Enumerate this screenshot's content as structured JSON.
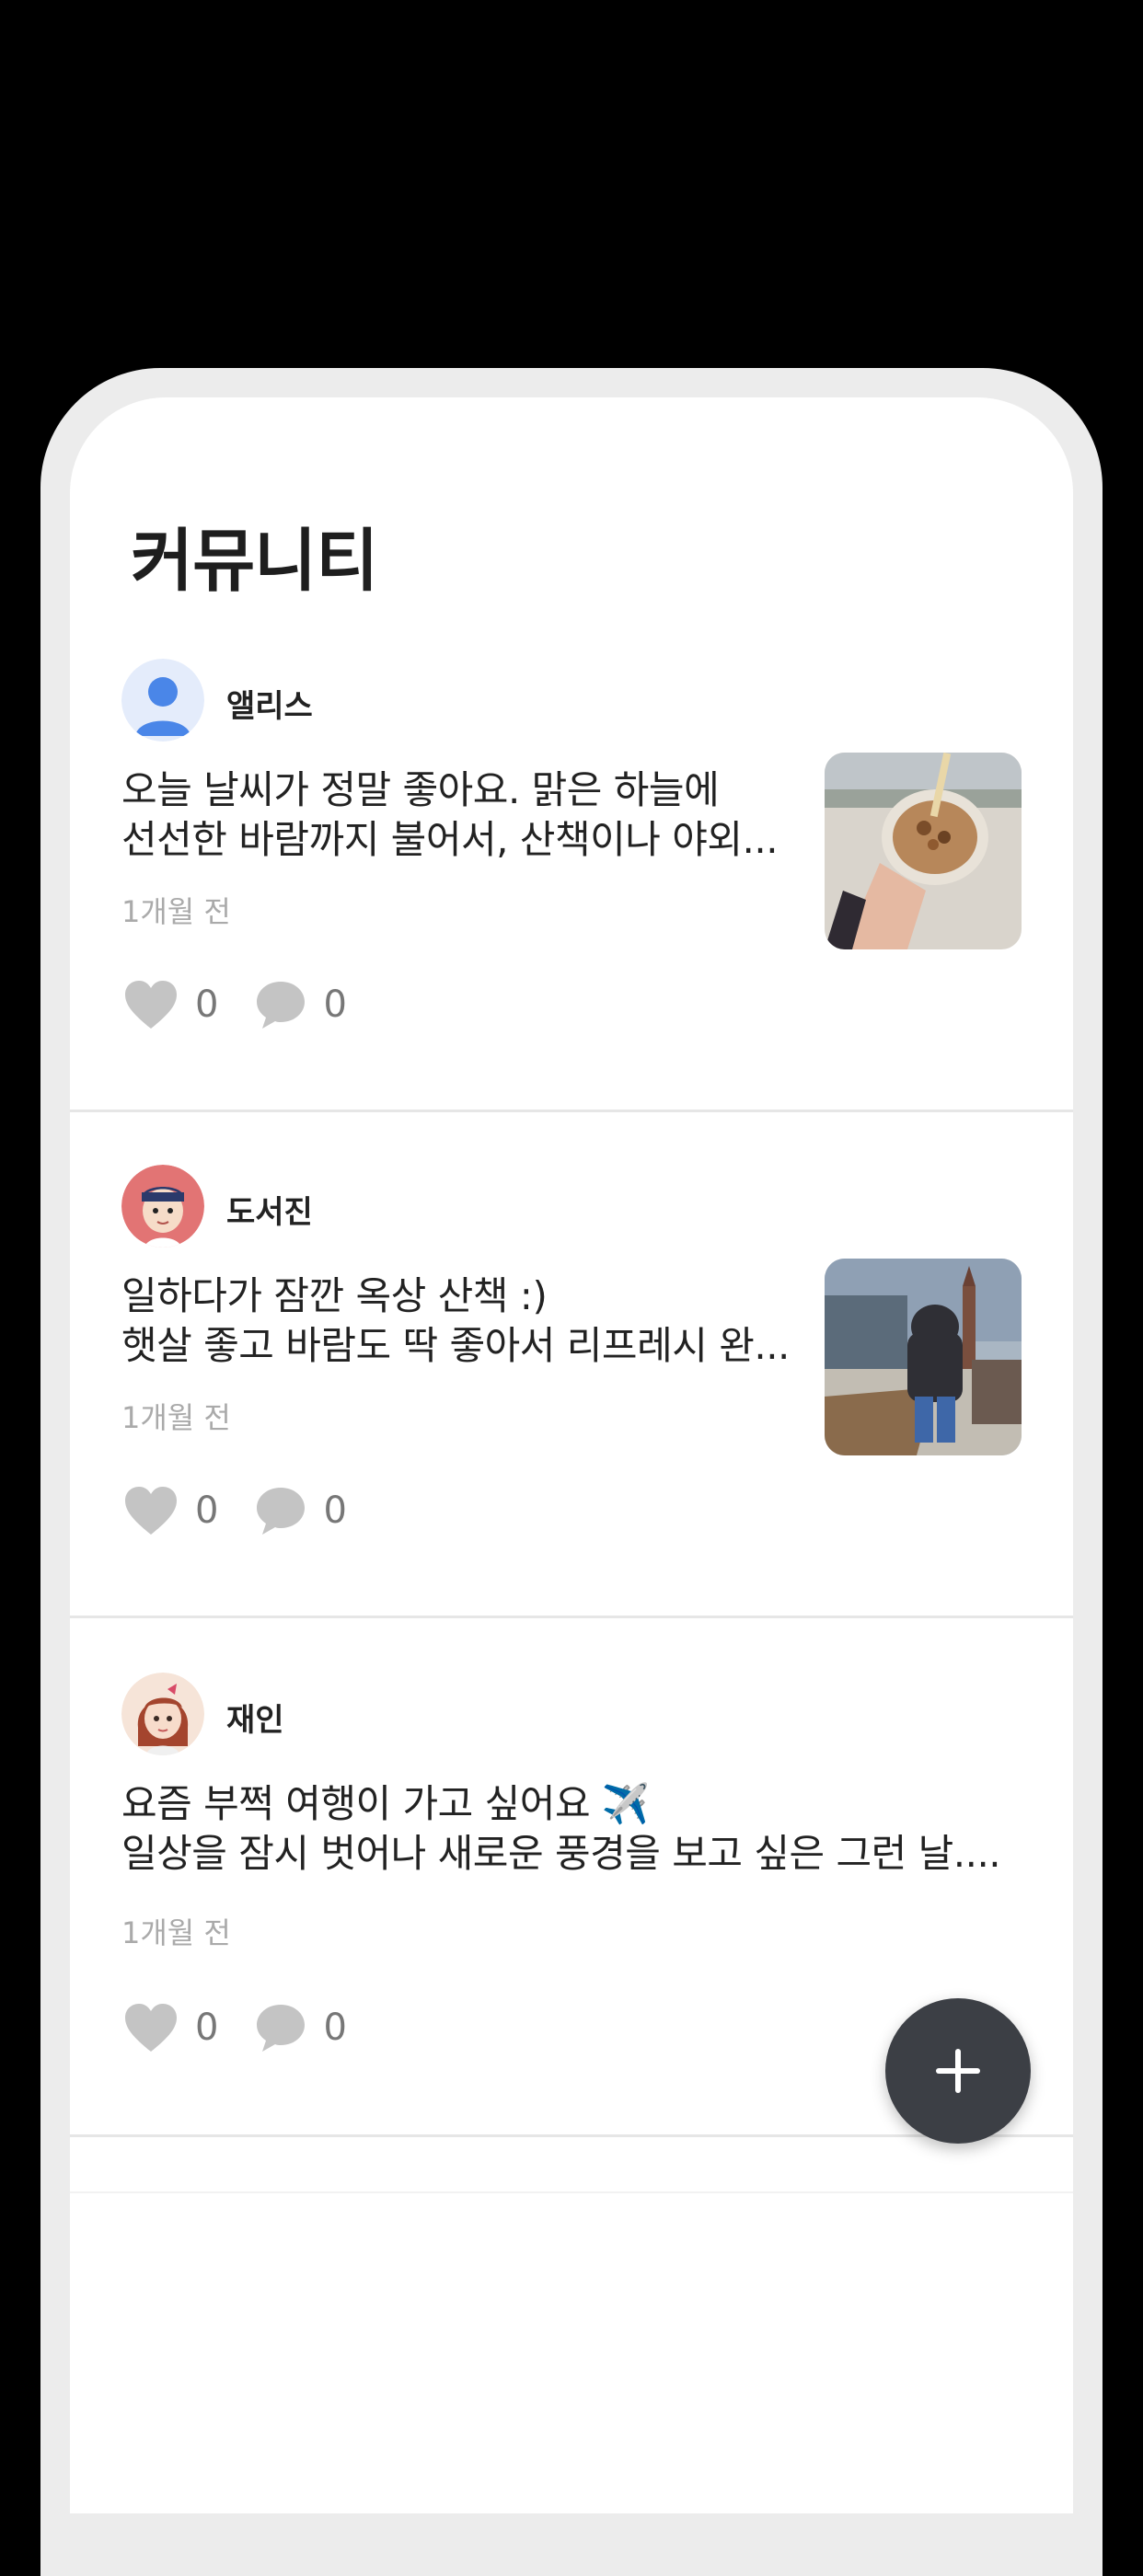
{
  "page": {
    "title": "커뮤니티"
  },
  "posts": [
    {
      "author": "앨리스",
      "avatar_icon": "default-person-avatar",
      "line1": "오늘 날씨가 정말 좋아요. 맑은 하늘에",
      "line2": "선선한 바람까지 불어서, 산책이나 야외...",
      "time": "1개월 전",
      "likes": "0",
      "comments": "0",
      "has_thumbnail": true
    },
    {
      "author": "도서진",
      "avatar_icon": "boy-character-avatar",
      "line1": "일하다가 잠깐 옥상 산책 :)",
      "line2": "햇살 좋고 바람도 딱 좋아서 리프레시 완...",
      "time": "1개월 전",
      "likes": "0",
      "comments": "0",
      "has_thumbnail": true
    },
    {
      "author": "재인",
      "avatar_icon": "girl-character-avatar",
      "line1": "요즘 부쩍 여행이 가고 싶어요 ✈️",
      "line2": "일상을 잠시 벗어나 새로운 풍경을 보고 싶은 그런 날....",
      "time": "1개월 전",
      "likes": "0",
      "comments": "0",
      "has_thumbnail": false
    }
  ],
  "fab": {
    "icon": "plus-icon"
  },
  "icons": {
    "like": "heart-icon",
    "comment": "speech-bubble-icon"
  },
  "colors": {
    "background": "#000000",
    "screen": "#ffffff",
    "frame": "#ececec",
    "text": "#222222",
    "muted": "#aaaaaa",
    "icon": "#c4c4c4",
    "fab": "#3c3f45"
  }
}
